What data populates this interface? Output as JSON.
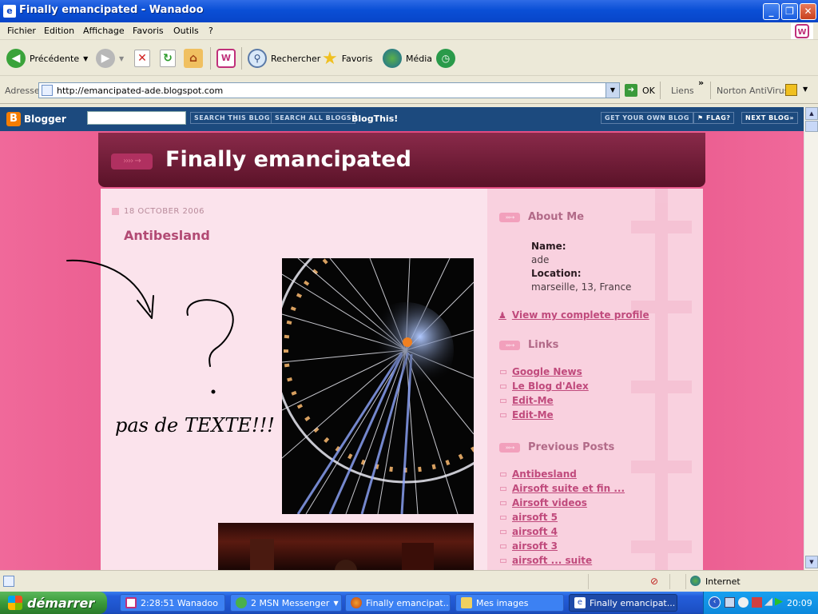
{
  "window": {
    "title": "Finally emancipated - Wanadoo"
  },
  "menu": {
    "items": [
      "Fichier",
      "Edition",
      "Affichage",
      "Favoris",
      "Outils",
      "?"
    ]
  },
  "toolbar": {
    "back_label": "Précédente",
    "search_label": "Rechercher",
    "favorites_label": "Favoris",
    "media_label": "Média"
  },
  "address": {
    "label": "Adresse",
    "url": "http://emancipated-ade.blogspot.com",
    "go_label": "OK",
    "links_label": "Liens",
    "antivirus_label": "Norton AntiVirus"
  },
  "blogger_bar": {
    "logo": "Blogger",
    "search_this_blog": "SEARCH THIS BLOG",
    "search_all_blogs": "SEARCH ALL BLOGS",
    "blogthis": "BlogThis!",
    "get_your_own_blog": "GET YOUR OWN BLOG",
    "flag": "FLAG?",
    "next_blog": "NEXT BLOG»"
  },
  "blog": {
    "title": "Finally emancipated",
    "post_date": "18 OCTOBER 2006",
    "post_title": "Antibesland",
    "annotation_text": "pas de TEXTE!!!"
  },
  "sidebar": {
    "about_heading": "About Me",
    "name_label": "Name:",
    "name_value": "ade",
    "location_label": "Location:",
    "location_value": "marseille, 13, France",
    "profile_link": "View my complete profile",
    "links_heading": "Links",
    "links": [
      "Google News",
      "Le Blog d'Alex",
      "Edit-Me",
      "Edit-Me"
    ],
    "previous_heading": "Previous Posts",
    "previous_posts": [
      "Antibesland",
      "Airsoft suite et fin ...",
      "Airsoft videos",
      "airsoft 5",
      "airsoft 4",
      "airsoft 3",
      "airsoft ... suite"
    ]
  },
  "statusbar": {
    "zone": "Internet"
  },
  "taskbar": {
    "start_label": "démarrer",
    "tasks": [
      "2:28:51 Wanadoo",
      "2 MSN Messenger",
      "Finally emancipat...",
      "Mes images",
      "Finally emancipat..."
    ],
    "clock": "20:09"
  }
}
